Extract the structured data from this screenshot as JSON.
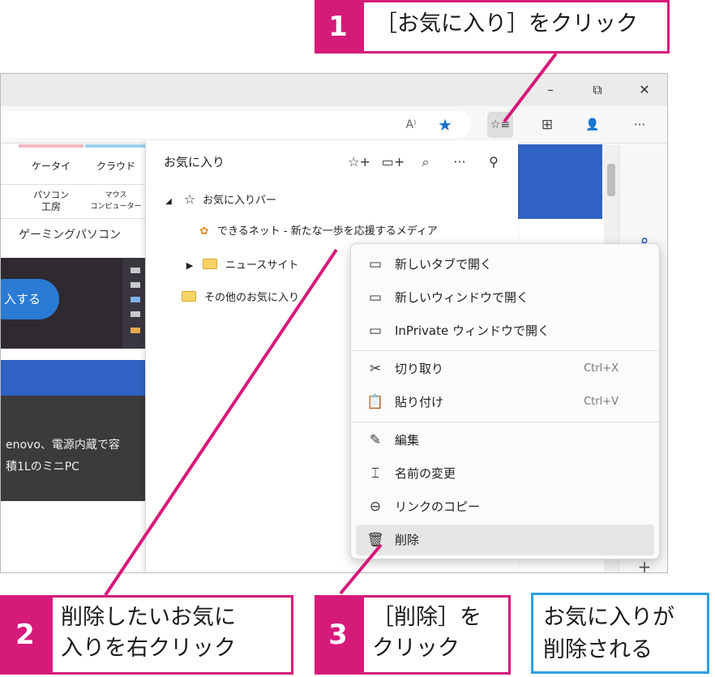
{
  "window": {
    "minimize": "–",
    "restore": "⧉",
    "close": "✕"
  },
  "toolbar": {
    "read_aloud_icon": "A⁾",
    "star_icon": "★",
    "favorites_icon": "☆≡",
    "collections_icon": "⊞",
    "profile_icon": "👤",
    "more_icon": "···"
  },
  "site": {
    "nav_tabs": [
      "ケータイ",
      "クラウド"
    ],
    "nav_sub": [
      {
        "line1": "パソコン",
        "line2": "工房"
      },
      {
        "line1": "マウス",
        "line2": "コンピューター"
      }
    ],
    "gaming_link": "ゲーミングパソコン",
    "cta_button": "入する",
    "article_line1": "enovo、電源内蔵で容",
    "article_line2": "積1LのミニPC"
  },
  "favorites": {
    "title": "お気に入り",
    "actions": {
      "add_favorite": "☆+",
      "add_folder": "▭+",
      "search": "⌕",
      "more": "···",
      "pin": "⚲"
    },
    "bar_label": "お気に入りバー",
    "item_site": "できるネット - 新たな一歩を応援するメディア",
    "item_news": "ニュースサイト",
    "item_other": "その他のお気に入り"
  },
  "context_menu": {
    "items": [
      {
        "icon": "▭",
        "label": "新しいタブで開く",
        "shortcut": ""
      },
      {
        "icon": "▭",
        "label": "新しいウィンドウで開く",
        "shortcut": ""
      },
      {
        "icon": "▭",
        "label": "InPrivate ウィンドウで開く",
        "shortcut": ""
      },
      {
        "icon": "✂",
        "label": "切り取り",
        "shortcut": "Ctrl+X"
      },
      {
        "icon": "📋",
        "label": "貼り付け",
        "shortcut": "Ctrl+V"
      },
      {
        "icon": "✎",
        "label": "編集",
        "shortcut": ""
      },
      {
        "icon": "⌶",
        "label": "名前の変更",
        "shortcut": ""
      },
      {
        "icon": "⊖",
        "label": "リンクのコピー",
        "shortcut": ""
      },
      {
        "icon": "🗑",
        "label": "削除",
        "shortcut": ""
      }
    ]
  },
  "callouts": {
    "step1_num": "1",
    "step1_text": "［お気に入り］をクリック",
    "step2_num": "2",
    "step2_line1": "削除したいお気に",
    "step2_line2": "入りを右クリック",
    "step3_num": "3",
    "step3_line1": "［削除］を",
    "step3_line2": "クリック",
    "result_line1": "お気に入りが",
    "result_line2": "削除される"
  },
  "colors": {
    "callout_accent": "#d61a7a",
    "result_accent": "#2f9fe0",
    "edge_blue": "#2f62c2"
  }
}
